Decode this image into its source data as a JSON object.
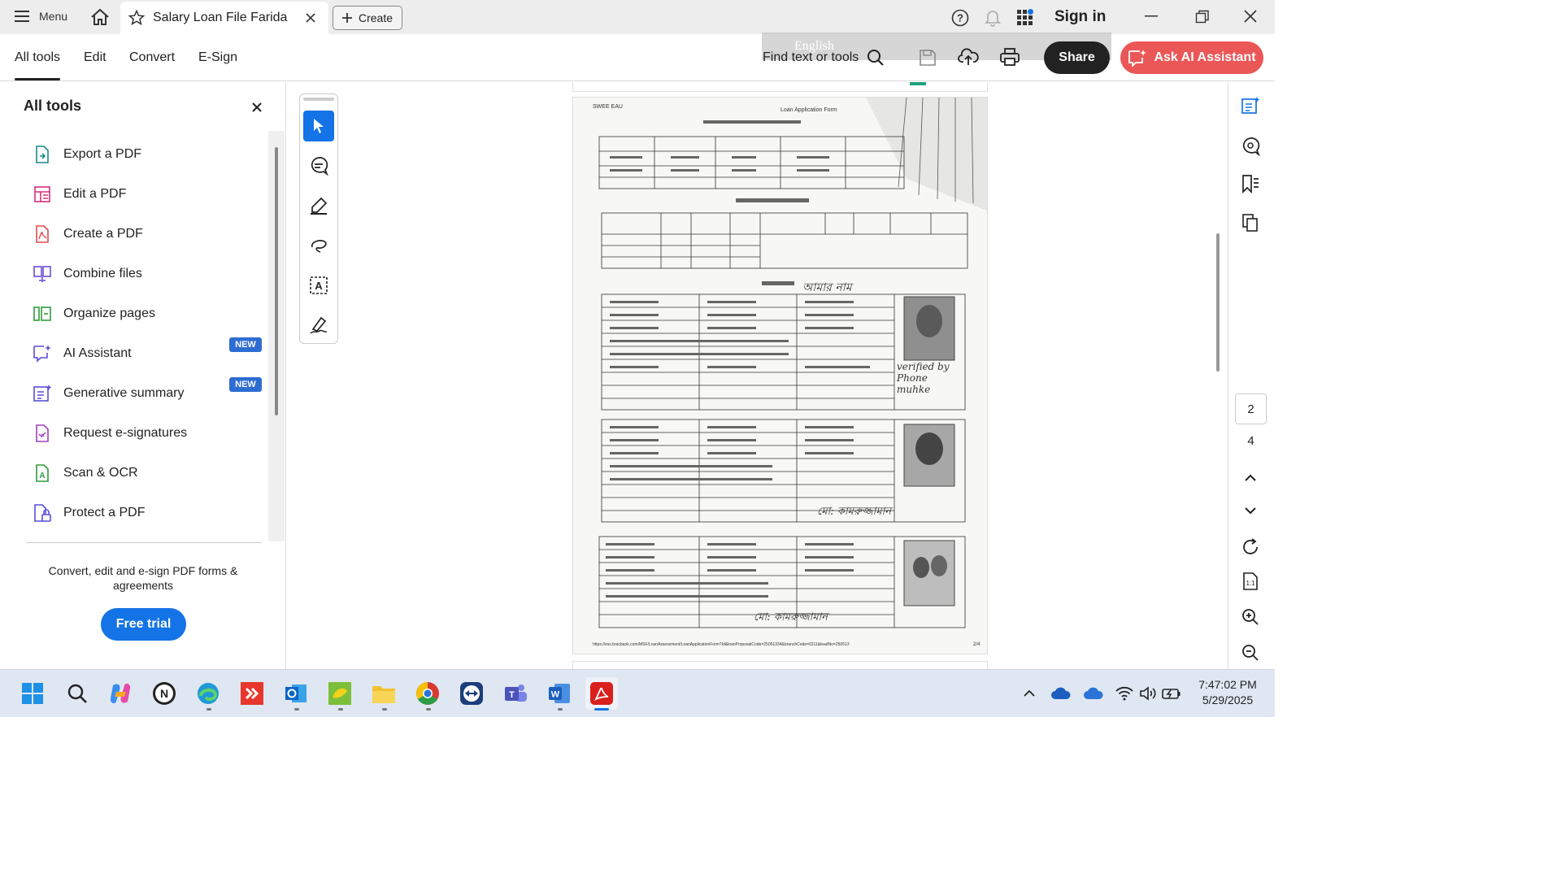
{
  "titlebar": {
    "menu_label": "Menu",
    "tab_title": "Salary Loan File Farida ...",
    "create_label": "Create",
    "signin_label": "Sign in"
  },
  "toolbar": {
    "tabs": [
      "All tools",
      "Edit",
      "Convert",
      "E-Sign"
    ],
    "find_label": "Find text or tools",
    "share_label": "Share",
    "ai_label": "Ask AI Assistant",
    "overlay_lang": "English"
  },
  "panel": {
    "title": "All tools",
    "items": [
      {
        "label": "Export a PDF",
        "icon": "export-pdf-icon",
        "color": "#1a8a8a"
      },
      {
        "label": "Edit a PDF",
        "icon": "edit-pdf-icon",
        "color": "#d9307c"
      },
      {
        "label": "Create a PDF",
        "icon": "create-pdf-icon",
        "color": "#e34850"
      },
      {
        "label": "Combine files",
        "icon": "combine-files-icon",
        "color": "#6a4fd9"
      },
      {
        "label": "Organize pages",
        "icon": "organize-pages-icon",
        "color": "#2d9d3a"
      },
      {
        "label": "AI Assistant",
        "icon": "ai-assistant-icon",
        "color": "#5a4fd9",
        "badge": "NEW"
      },
      {
        "label": "Generative summary",
        "icon": "generative-summary-icon",
        "color": "#5a4fd9",
        "badge": "NEW"
      },
      {
        "label": "Request e-signatures",
        "icon": "request-esign-icon",
        "color": "#a040c0"
      },
      {
        "label": "Scan & OCR",
        "icon": "scan-ocr-icon",
        "color": "#2d9d3a"
      },
      {
        "label": "Protect a PDF",
        "icon": "protect-pdf-icon",
        "color": "#5a4fd9"
      }
    ],
    "promo_text": "Convert, edit and e-sign PDF forms & agreements",
    "free_trial_label": "Free trial"
  },
  "document": {
    "header_left": "SWEE EAU",
    "header_right": "Loan Application Form",
    "handwriting": {
      "sig1": "আমার নাম",
      "verified": "verified by Phone muhke",
      "sig2": "মো: কামরুজ্জামান",
      "sig3": "মো: কামরুজ্জামান"
    },
    "footer_url": "https://ess.bracbank.com/MSF/LoanAssessment/LoanApplicationForm?Id&loanProposalCode=25051334&branchCode=0211&leadNo=250513",
    "footer_page": "2/4"
  },
  "page_nav": {
    "current": "2",
    "total": "4"
  },
  "clock": {
    "time": "7:47:02 PM",
    "date": "5/29/2025"
  },
  "colors": {
    "accent_blue": "#1473e6",
    "ai_red": "#eb5757",
    "share_dark": "#222222"
  }
}
